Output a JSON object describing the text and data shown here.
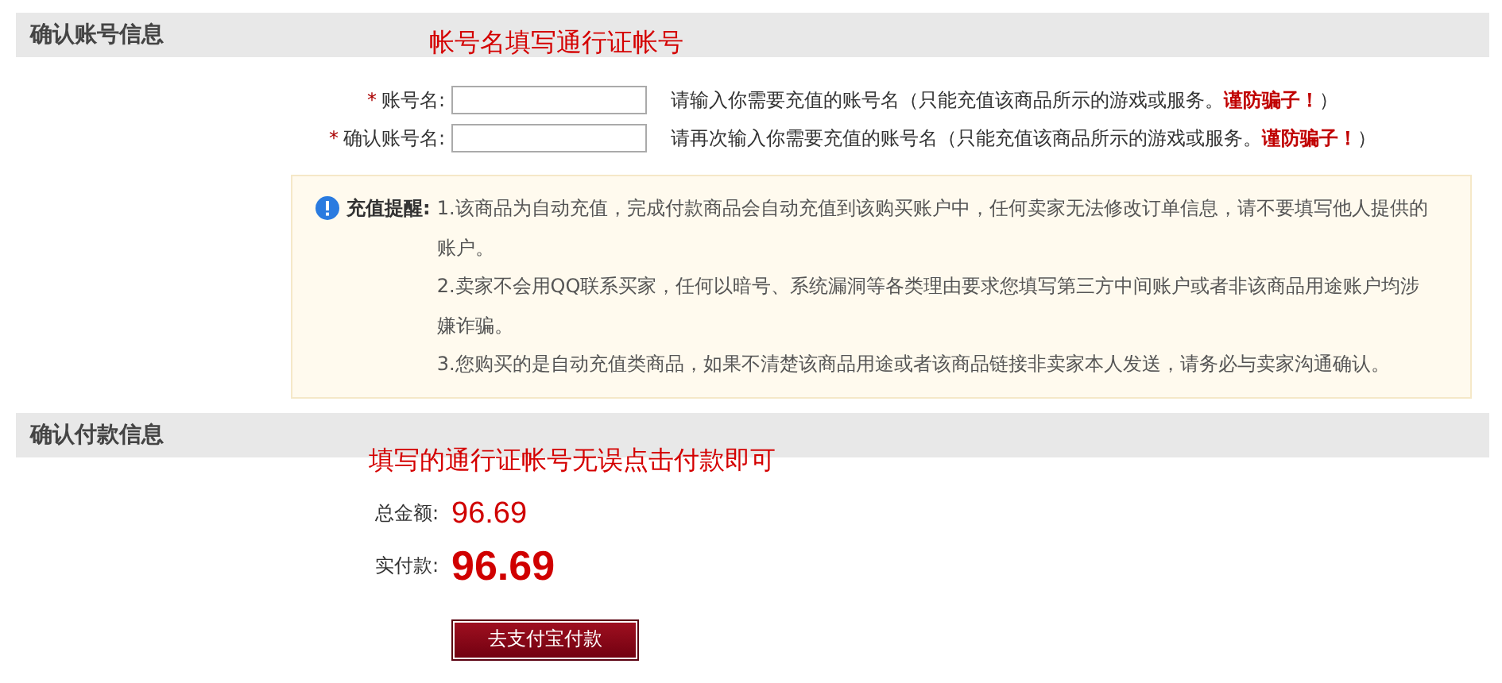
{
  "account_section": {
    "title": "确认账号信息",
    "annotation": "帐号名填写通行证帐号",
    "fields": [
      {
        "required_mark": "*",
        "label": "账号名:",
        "help": "请输入你需要充值的账号名（只能充值该商品所示的游戏或服务。",
        "warning": "谨防骗子！",
        "help_end": "）"
      },
      {
        "required_mark": "*",
        "label": "确认账号名:",
        "help": "请再次输入你需要充值的账号名（只能充值该商品所示的游戏或服务。",
        "warning": "谨防骗子！",
        "help_end": "）"
      }
    ],
    "notice": {
      "title": "充值提醒:",
      "items": [
        "1.该商品为自动充值，完成付款商品会自动充值到该购买账户中，任何卖家无法修改订单信息，请不要填写他人提供的账户。",
        "2.卖家不会用QQ联系买家，任何以暗号、系统漏洞等各类理由要求您填写第三方中间账户或者非该商品用途账户均涉嫌诈骗。",
        "3.您购买的是自动充值类商品，如果不清楚该商品用途或者该商品链接非卖家本人发送，请务必与卖家沟通确认。"
      ]
    }
  },
  "payment_section": {
    "title": "确认付款信息",
    "annotation": "填写的通行证帐号无误点击付款即可",
    "total": {
      "label": "总金额:",
      "value": "96.69"
    },
    "actual": {
      "label": "实付款:",
      "value": "96.69"
    },
    "button": "去支付宝付款"
  }
}
